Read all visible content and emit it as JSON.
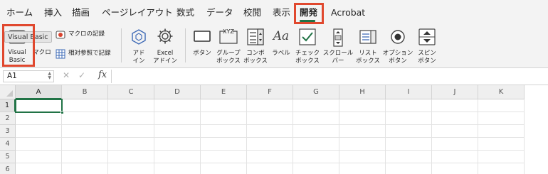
{
  "tabs": [
    "ホーム",
    "挿入",
    "描画",
    "ページレイアウト",
    "数式",
    "データ",
    "校閲",
    "表示",
    "開発",
    "Acrobat"
  ],
  "active_tab": "開発",
  "ribbon": {
    "tooltip": "Visual Basic",
    "visual_basic": "Visual\nBasic",
    "macros": "マクロ",
    "record_macro": "マクロの記録",
    "relative_refs": "相対参照で記録",
    "addins": "アド\nイン",
    "excel_addins": "Excel\nアドイン",
    "button": "ボタン",
    "group_box": "グループ\nボックス",
    "combo_box": "コンボ\nボックス",
    "label": "ラベル",
    "check_box": "チェック\nボックス",
    "scroll_bar": "スクロール\nバー",
    "list_box": "リスト\nボックス",
    "option_button": "オプション\nボタン",
    "spin_button": "スピン\nボタン",
    "label_icon_text": "Aa",
    "group_icon_text": "XYZ"
  },
  "formula_bar": {
    "name_box": "A1",
    "cancel": "✕",
    "enter": "✓",
    "fx": "fx",
    "value": ""
  },
  "grid": {
    "columns": [
      "A",
      "B",
      "C",
      "D",
      "E",
      "F",
      "G",
      "H",
      "I",
      "J",
      "K"
    ],
    "rows": [
      "1",
      "2",
      "3",
      "4",
      "5",
      "6"
    ],
    "selected_cell": "A1"
  },
  "colors": {
    "accent": "#217346",
    "highlight": "#e0482e",
    "ribbon_bg": "#f3f3f3"
  }
}
